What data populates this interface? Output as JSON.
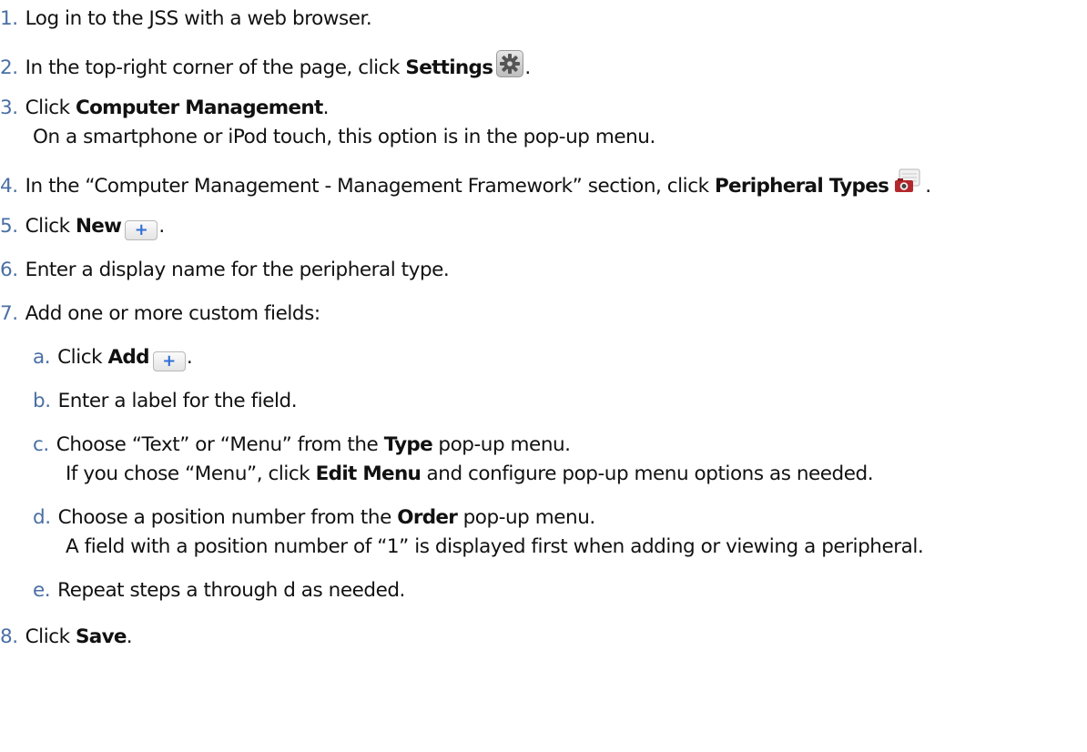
{
  "steps": {
    "s1": {
      "num": "1.",
      "text": "Log in to the JSS with a web browser."
    },
    "s2": {
      "num": "2.",
      "pre": "In the top-right corner of the page, click ",
      "bold": "Settings",
      "post": "."
    },
    "s3": {
      "num": "3.",
      "pre": "Click ",
      "bold": "Computer Management",
      "post": ".",
      "note": "On a smartphone or iPod touch, this option is in the pop-up menu."
    },
    "s4": {
      "num": "4.",
      "pre": "In the “Computer Management - Management Framework” section, click ",
      "bold": "Peripheral Types",
      "post": "."
    },
    "s5": {
      "num": "5.",
      "pre": "Click ",
      "bold": "New",
      "post": "."
    },
    "s6": {
      "num": "6.",
      "text": "Enter a display name for the peripheral type."
    },
    "s7": {
      "num": "7.",
      "text": "Add one or more custom fields:"
    },
    "s8": {
      "num": "8.",
      "pre": "Click ",
      "bold": "Save",
      "post": "."
    }
  },
  "substeps": {
    "a": {
      "num": "a.",
      "pre": "Click ",
      "bold": "Add",
      "post": "."
    },
    "b": {
      "num": "b.",
      "text": "Enter a label for the field."
    },
    "c": {
      "num": "c.",
      "pre": "Choose “Text” or “Menu” from the ",
      "bold": "Type",
      "post": " pop-up menu.",
      "note_pre": "If you chose “Menu”, click ",
      "note_bold": "Edit Menu",
      "note_post": " and configure pop-up menu options as needed."
    },
    "d": {
      "num": "d.",
      "pre": "Choose a position number from the ",
      "bold": "Order",
      "post": " pop-up menu.",
      "note": "A field with a position number of “1” is displayed first when adding or viewing a peripheral."
    },
    "e": {
      "num": "e.",
      "text": "Repeat steps a through d as needed."
    }
  },
  "icons": {
    "settings": "gear-icon",
    "peripheral_types": "peripheral-camera-icon",
    "new": "plus-button-icon",
    "add": "plus-button-icon",
    "plus_glyph": "+"
  },
  "colors": {
    "step_number": "#4a6fa5",
    "plus": "#2f6fd6",
    "peripheral_red": "#b3282d"
  }
}
